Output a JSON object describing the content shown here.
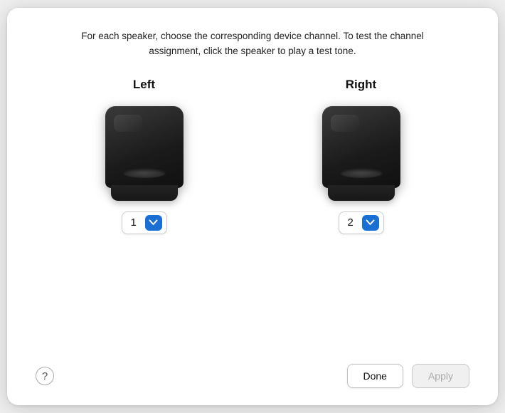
{
  "dialog": {
    "description": "For each speaker, choose the corresponding device channel. To test the channel assignment, click the speaker to play a test tone."
  },
  "speakers": [
    {
      "id": "left",
      "label": "Left",
      "channel_value": "1"
    },
    {
      "id": "right",
      "label": "Right",
      "channel_value": "2"
    }
  ],
  "footer": {
    "help_symbol": "?",
    "done_label": "Done",
    "apply_label": "Apply"
  }
}
